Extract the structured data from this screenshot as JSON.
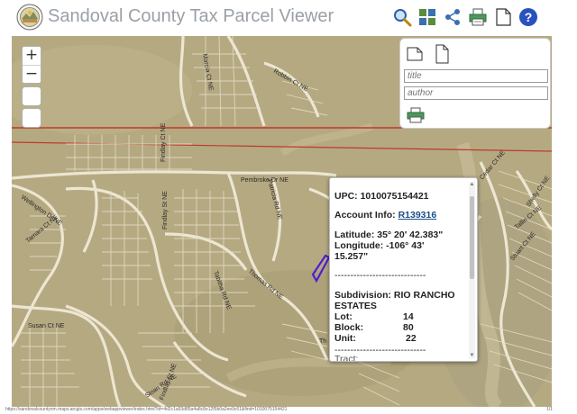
{
  "app": {
    "title": "Sandoval County Tax Parcel Viewer"
  },
  "toolbar": {
    "icons": [
      "search-icon",
      "grid-icon",
      "share-icon",
      "print-icon",
      "document-icon",
      "help-icon"
    ],
    "help_label": "?"
  },
  "map_controls": {
    "zoom_in": "+",
    "zoom_out": "−"
  },
  "print_panel": {
    "title_placeholder": "title",
    "author_placeholder": "author"
  },
  "map_labels": {
    "pembroke": "Pembroke Dr NE",
    "wellington": "Wellington Dr NE",
    "findlay_top": "Findlay Ct NE",
    "findlay_mid": "Findlay St NE",
    "findlay_low": "Findlay St NE",
    "susan": "Susan Ct NE",
    "sloan": "Sloan Rd NE",
    "thomas": "Thomas Rd NE",
    "tabitha": "Tabitha Rd NE",
    "patricia": "Patricia Rd NE",
    "tamara": "Tamara Ct NE",
    "marcia": "Marcia Ct NE",
    "robbin": "Robbin Ct NE",
    "cedar": "Cedar Ct NE",
    "shelly": "Shelly Ct NE",
    "stuart": "Stuart Ct NE",
    "tallin": "Tallin Ct NE",
    "thw": "Th"
  },
  "popup": {
    "upc_label": "UPC:",
    "upc_value": "1010075154421",
    "account_label": "Account Info:",
    "account_value": "R139316",
    "latitude_label": "Latitude:",
    "latitude_value": "35° 20' 42.383\"",
    "longitude_label": "Longitude:",
    "longitude_value": "-106° 43'",
    "longitude_value_cont": "15.257\"",
    "divider": "-----------------------------",
    "subdivision_label": "Subdivision:",
    "subdivision_value": "RIO RANCHO",
    "subdivision_value_cont": "ESTATES",
    "lot_label": "Lot:",
    "lot_value": "14",
    "block_label": "Block:",
    "block_value": "80",
    "unit_label": "Unit:",
    "unit_value": "22",
    "divider2": "-----------------------------",
    "cut_text": "Tract:"
  },
  "colors": {
    "roads_red": "#c0392b",
    "parcel_highlight": "#4b1fd0",
    "link": "#1a4e8a"
  },
  "status": {
    "url": "https://sandovalcountynm.maps.arcgis.com/apps/webappviewer/index.html?id=4d2c1a93d85a4a8c8e12f5b0a2ee9c61&find=1010075154421",
    "page": "1/1"
  }
}
